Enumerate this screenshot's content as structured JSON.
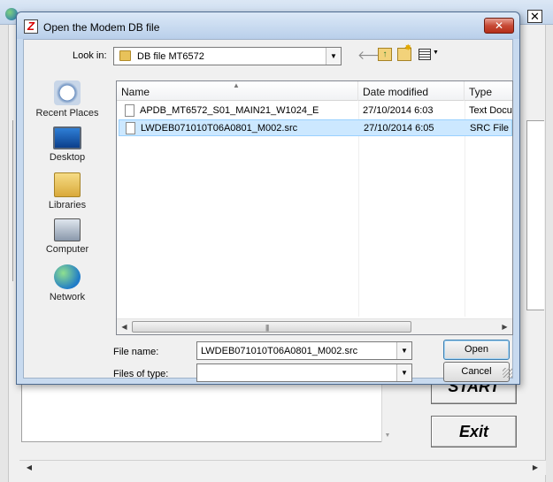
{
  "background_app": {
    "close_glyph": "✕",
    "start_label": "START",
    "exit_label": "Exit"
  },
  "dialog": {
    "title": "Open the Modem DB file",
    "close_glyph": "✕",
    "look_in_label": "Look in:",
    "look_in_value": "DB file MT6572",
    "places": [
      {
        "label": "Recent Places",
        "icon": "recent-places-icon"
      },
      {
        "label": "Desktop",
        "icon": "desktop-icon"
      },
      {
        "label": "Libraries",
        "icon": "libraries-icon"
      },
      {
        "label": "Computer",
        "icon": "computer-icon"
      },
      {
        "label": "Network",
        "icon": "network-icon"
      }
    ],
    "columns": {
      "name": "Name",
      "date": "Date modified",
      "type": "Type"
    },
    "files": [
      {
        "name": "APDB_MT6572_S01_MAIN21_W1024_E",
        "date": "27/10/2014 6:03",
        "type": "Text Document",
        "selected": false
      },
      {
        "name": "LWDEB071010T06A0801_M002.src",
        "date": "27/10/2014 6:05",
        "type": "SRC File",
        "selected": true
      }
    ],
    "file_name_label": "File name:",
    "file_name_value": "LWDEB071010T06A0801_M002.src",
    "files_of_type_label": "Files of type:",
    "files_of_type_value": "",
    "open_label": "Open",
    "cancel_label": "Cancel"
  },
  "colors": {
    "selection": "#cce8ff",
    "title_bar": "#c8daef",
    "close_button": "#c74a36"
  }
}
